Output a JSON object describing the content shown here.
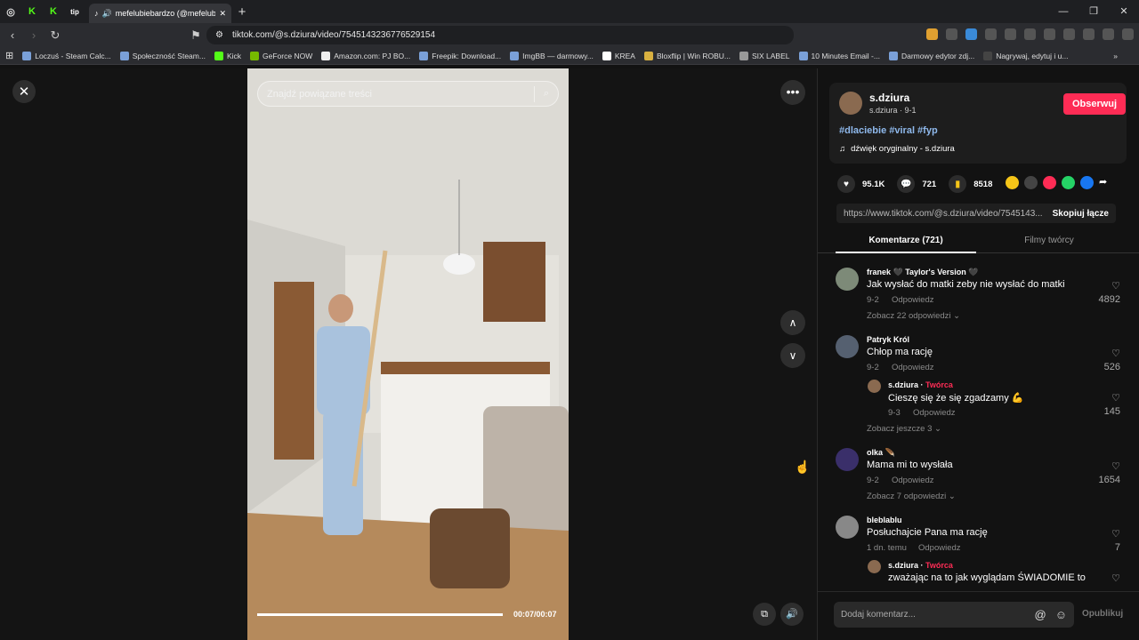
{
  "browser": {
    "tab_title": "mefelubiebardzo (@mefelub",
    "url": "tiktok.com/@s.dziura/video/7545143236776529154",
    "bookmarks": [
      "Loczuś - Steam Calc...",
      "Społeczność Steam...",
      "Kick",
      "GeForce NOW",
      "Amazon.com: PJ BO...",
      "Freepik: Download...",
      "ImgBB — darmowy...",
      "KREA",
      "Bloxflip | Win ROBU...",
      "SIX LABEL",
      "10 Minutes Email -...",
      "Darmowy edytor zdj...",
      "Nagrywaj, edytuj i u..."
    ]
  },
  "video": {
    "search_placeholder": "Znajdź powiązane treści",
    "time": "00:07/00:07",
    "progress": 1.0
  },
  "author": {
    "name": "s.dziura",
    "sub": "s.dziura · 9-1",
    "follow_label": "Obserwuj",
    "hashtags": "#dlaciebie #viral #fyp",
    "sound": "dźwięk oryginalny - s.dziura"
  },
  "stats": {
    "likes": "95.1K",
    "comments": "721",
    "saves": "8518"
  },
  "link": {
    "url": "https://www.tiktok.com/@s.dziura/video/7545143...",
    "copy_label": "Skopiuj łącze"
  },
  "tabs": {
    "comments": "Komentarze (721)",
    "creator_videos": "Filmy twórcy"
  },
  "comments": [
    {
      "name": "franek 🖤 Taylor's Version 🖤",
      "text": "Jak wysłać do matki zeby nie wysłać do matki",
      "date": "9-2",
      "reply": "Odpowiedz",
      "likes": "4892",
      "more": "Zobacz 22 odpowiedzi ⌄"
    },
    {
      "name": "Patryk Król",
      "text": "Chłop ma rację",
      "date": "9-2",
      "reply": "Odpowiedz",
      "likes": "526",
      "sub": {
        "name": "s.dziura · ",
        "creator": "Twórca",
        "text": "Cieszę się że się zgadzamy 💪",
        "date": "9-3",
        "reply": "Odpowiedz",
        "likes": "145"
      },
      "more": "Zobacz jeszcze 3 ⌄"
    },
    {
      "name": "olka 🪶",
      "text": "Mama mi to wysłała",
      "date": "9-2",
      "reply": "Odpowiedz",
      "likes": "1654",
      "more": "Zobacz 7 odpowiedzi ⌄"
    },
    {
      "name": "bleblablu",
      "text": "Posłuchajcie Pana ma rację",
      "date": "1 dn. temu",
      "reply": "Odpowiedz",
      "likes": "7",
      "sub": {
        "name": "s.dziura · ",
        "creator": "Twórca",
        "text": "zważając na to jak wyglądam ŚWIADOMIE to",
        "date": "",
        "reply": "",
        "likes": ""
      }
    }
  ],
  "comment_box": {
    "placeholder": "Dodaj komentarz...",
    "post_label": "Opublikuj"
  }
}
